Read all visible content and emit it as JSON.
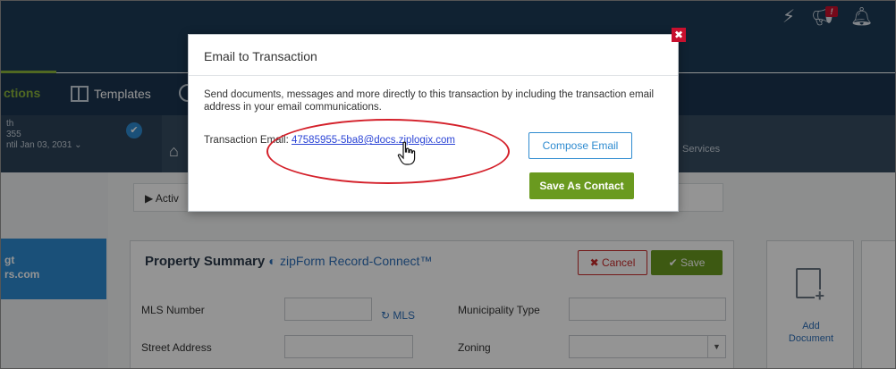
{
  "nav": {
    "active_label": "ctions",
    "templates_label": "Templates"
  },
  "subheader": {
    "left_line1": "th",
    "left_line2": "355",
    "left_line3": "ntil Jan 03, 2031 ⌄",
    "services_label": "Services"
  },
  "activity": {
    "label": "▶  Activ"
  },
  "sidebar": {
    "line1": "gt",
    "line2": "rs.com"
  },
  "property_summary": {
    "title": "Property Summary",
    "zipform_label": "zipForm Record-Connect™",
    "cancel_label": "✖  Cancel",
    "save_label": "✔  Save",
    "fields": {
      "mls_number": "MLS Number",
      "mls_link": "MLS",
      "municipality_type": "Municipality Type",
      "street_address": "Street Address",
      "zoning": "Zoning"
    }
  },
  "add_document": {
    "line1": "Add",
    "line2": "Document"
  },
  "modal": {
    "title": "Email to Transaction",
    "description": "Send documents, messages and more directly to this transaction by including the transaction email address in your email communications.",
    "email_label": "Transaction Email: ",
    "email_value": "47585955-5ba8@docs.ziplogix.com",
    "compose_label": "Compose Email",
    "save_contact_label": "Save As Contact",
    "close_glyph": "✖"
  },
  "topbar_icons": [
    "bolt-icon",
    "megaphone-icon",
    "bell-icon"
  ],
  "colors": {
    "header_bg": "#1d3c56",
    "accent_green": "#8ab43c",
    "save_green": "#6a9a1f",
    "link_blue": "#2b44d6",
    "close_red": "#c8102e",
    "highlight_ellipse": "#d4202a"
  }
}
